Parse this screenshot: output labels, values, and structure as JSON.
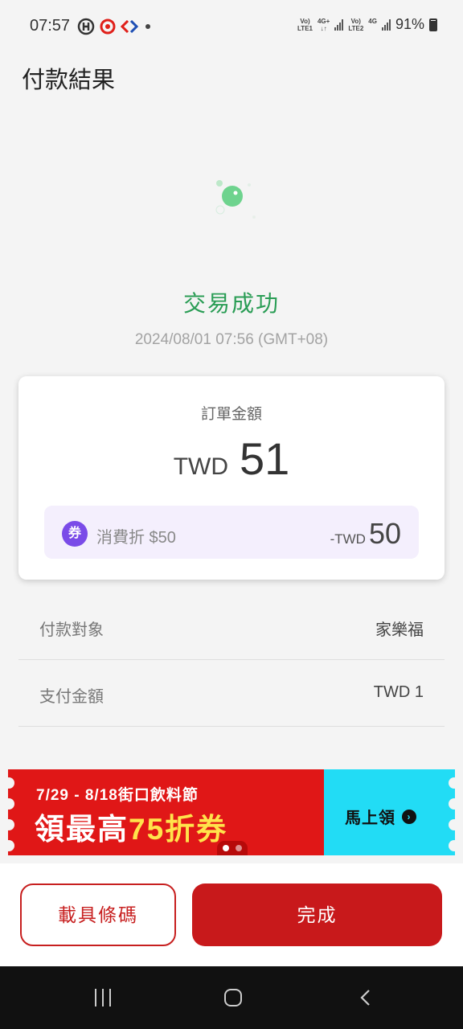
{
  "status_bar": {
    "time": "07:57",
    "net1_top": "Vo)",
    "net1_bottom": "LTE1",
    "net1_type": "4G+",
    "net2_top": "Vo)",
    "net2_bottom": "LTE2",
    "net2_type": "4G",
    "battery": "91%"
  },
  "header": {
    "title": "付款結果"
  },
  "result": {
    "status": "交易成功",
    "datetime": "2024/08/01 07:56 (GMT+08)"
  },
  "order": {
    "label": "訂單金額",
    "currency": "TWD",
    "amount": "51",
    "discount": {
      "icon_text": "券",
      "label": "消費折 $50",
      "currency": "-TWD",
      "amount": "50"
    }
  },
  "details": [
    {
      "label": "付款對象",
      "value": "家樂福"
    },
    {
      "label": "支付金額",
      "value": "TWD 1"
    }
  ],
  "banner": {
    "subtitle": "7/29 - 8/18街口飲料節",
    "title_prefix": "領最高",
    "title_highlight": "75折券",
    "cta": "馬上領",
    "colors": {
      "left": "#e01717",
      "right": "#22dcf5",
      "highlight": "#ffe34b"
    }
  },
  "actions": {
    "secondary": "載具條碼",
    "primary": "完成"
  },
  "colors": {
    "success": "#2a9d55",
    "primary_button": "#c8191b",
    "coupon_icon": "#7a4be8"
  }
}
